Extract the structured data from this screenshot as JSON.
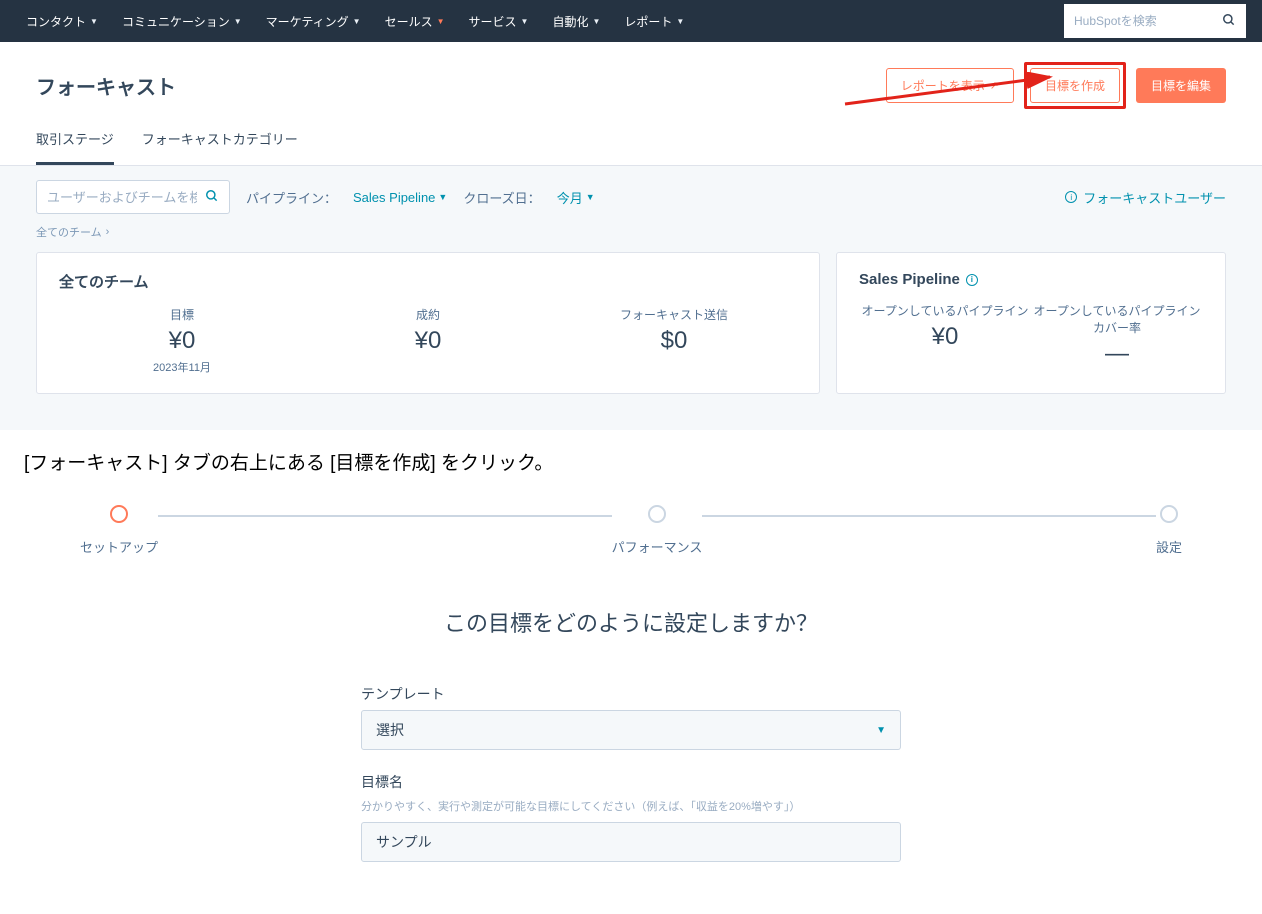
{
  "topnav": {
    "items": [
      "コンタクト",
      "コミュニケーション",
      "マーケティング",
      "セールス",
      "サービス",
      "自動化",
      "レポート"
    ],
    "active_index": 3,
    "search_placeholder": "HubSpotを検索"
  },
  "page": {
    "title": "フォーキャスト"
  },
  "header_actions": {
    "show_report": "レポートを表示",
    "create_goal": "目標を作成",
    "edit_goal": "目標を編集"
  },
  "tabs": {
    "items": [
      "取引ステージ",
      "フォーキャストカテゴリー"
    ],
    "active_index": 0
  },
  "filters": {
    "search_placeholder": "ユーザーおよびチームを検索",
    "pipeline_label": "パイプライン：",
    "pipeline_value": "Sales Pipeline",
    "close_date_label": "クローズ日：",
    "close_date_value": "今月",
    "forecast_user_link": "フォーキャストユーザー",
    "breadcrumb": "全てのチーム"
  },
  "cards": {
    "teams": {
      "title": "全てのチーム",
      "metrics": [
        {
          "label": "目標",
          "value": "¥0",
          "sub": "2023年11月"
        },
        {
          "label": "成約",
          "value": "¥0",
          "sub": ""
        },
        {
          "label": "フォーキャスト送信",
          "value": "$0",
          "sub": ""
        }
      ]
    },
    "pipeline": {
      "title": "Sales Pipeline",
      "metrics": [
        {
          "label": "オープンしているパイプライン",
          "value": "¥0"
        },
        {
          "label": "オープンしているパイプラインカバー率",
          "value": "—"
        }
      ]
    }
  },
  "caption": "[フォーキャスト] タブの右上にある [目標を作成] をクリック。",
  "stepper": {
    "steps": [
      "セットアップ",
      "パフォーマンス",
      "設定"
    ],
    "active_index": 0
  },
  "form": {
    "heading": "この目標をどのように設定しますか？",
    "template_label": "テンプレート",
    "template_value": "選択",
    "goal_name_label": "目標名",
    "goal_name_help": "分かりやすく、実行や測定が可能な目標にしてください（例えば、「収益を20%増やす」）",
    "goal_name_value": "サンプル"
  }
}
